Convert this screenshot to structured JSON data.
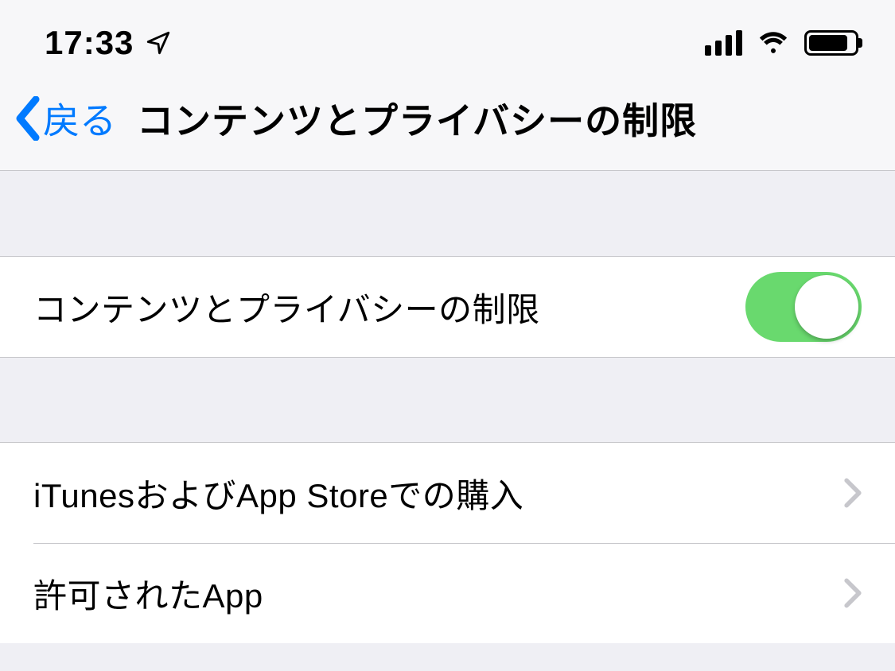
{
  "status": {
    "time": "17:33"
  },
  "nav": {
    "back_label": "戻る",
    "title": "コンテンツとプライバシーの制限"
  },
  "section_toggle": {
    "label": "コンテンツとプライバシーの制限",
    "enabled": true
  },
  "section_links": {
    "items": [
      {
        "label": "iTunesおよびApp Storeでの購入"
      },
      {
        "label": "許可されたApp"
      }
    ]
  },
  "colors": {
    "accent": "#007aff",
    "toggle_on": "#69d96e"
  }
}
